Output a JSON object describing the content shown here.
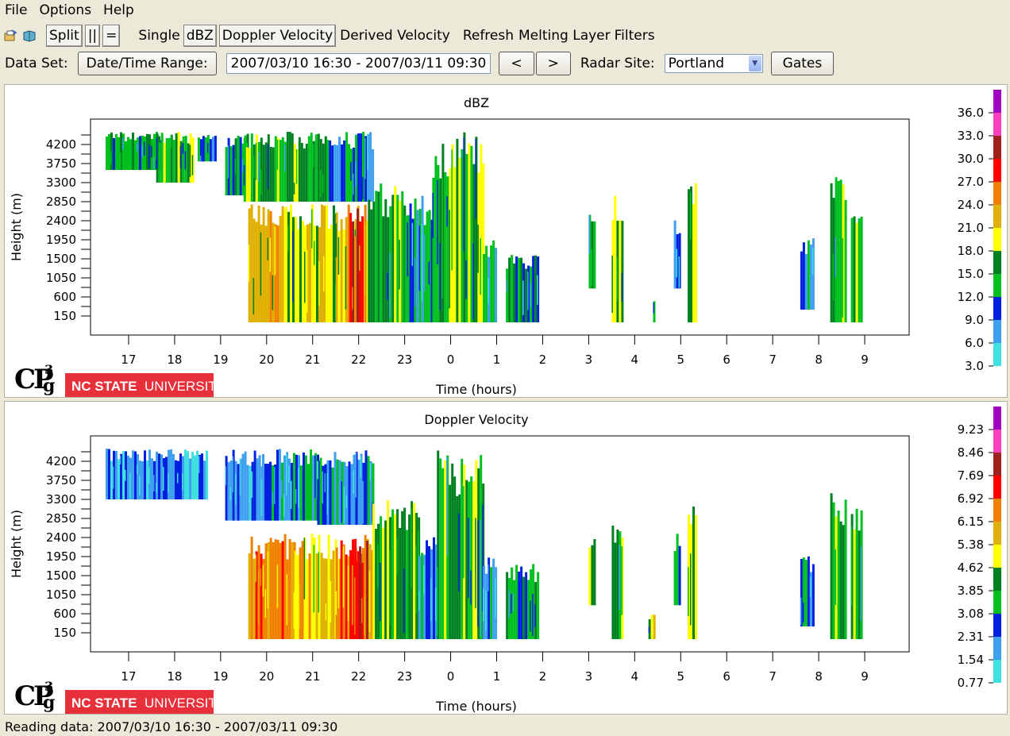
{
  "menu": [
    "File",
    "Options",
    "Help"
  ],
  "toolbar": {
    "split_label": "Split",
    "parallel_label": "||",
    "equal_label": "=",
    "single_label": "Single",
    "dbz_label": "dBZ",
    "doppler_label": "Doppler Velocity",
    "derived_label": "Derived Velocity",
    "refresh_label": "Refresh",
    "melting_label": "Melting Layer",
    "filters_label": "Filters"
  },
  "dataset": {
    "label": "Data Set:",
    "range_button": "Date/Time Range:",
    "range_value": "2007/03/10 16:30 - 2007/03/11 09:30",
    "prev_label": "<",
    "next_label": ">",
    "site_label": "Radar Site:",
    "site_value": "Portland",
    "gates_label": "Gates"
  },
  "colors": [
    "#40e0e0",
    "#40a0f0",
    "#0020e0",
    "#00c020",
    "#008020",
    "#ffff00",
    "#e0b000",
    "#f08000",
    "#ff0000",
    "#a02020",
    "#ff40c0",
    "#a000c0"
  ],
  "chart_data": [
    {
      "type": "heatmap",
      "title": "dBZ",
      "xlabel": "Time (hours)",
      "ylabel": "Height (m)",
      "xticks": [
        "17",
        "18",
        "19",
        "20",
        "21",
        "22",
        "23",
        "0",
        "1",
        "2",
        "3",
        "4",
        "5",
        "6",
        "7",
        "8",
        "9"
      ],
      "yticks": [
        "4200",
        "3750",
        "3300",
        "2850",
        "2400",
        "1950",
        "1500",
        "1050",
        "600",
        "150"
      ],
      "colorbar_labels": [
        "36.0",
        "33.0",
        "30.0",
        "27.0",
        "24.0",
        "21.0",
        "18.0",
        "15.0",
        "12.0",
        "9.0",
        "6.0",
        "3.0"
      ],
      "colorbar_values": [
        36.0,
        33.0,
        30.0,
        27.0,
        24.0,
        21.0,
        18.0,
        15.0,
        12.0,
        9.0,
        6.0,
        3.0
      ],
      "echo_blocks": [
        {
          "t0": 16.5,
          "t1": 17.7,
          "h0": 3600,
          "h1": 4500,
          "level": 3
        },
        {
          "t0": 17.6,
          "t1": 18.4,
          "h0": 3300,
          "h1": 4500,
          "level": 4
        },
        {
          "t0": 18.5,
          "t1": 18.9,
          "h0": 3800,
          "h1": 4500,
          "level": 2
        },
        {
          "t0": 19.1,
          "t1": 19.6,
          "h0": 3000,
          "h1": 4500,
          "level": 3
        },
        {
          "t0": 19.5,
          "t1": 21.3,
          "h0": 2850,
          "h1": 4500,
          "level": 4
        },
        {
          "t0": 21.3,
          "t1": 22.3,
          "h0": 2850,
          "h1": 4500,
          "level": 2
        },
        {
          "t0": 19.6,
          "t1": 20.4,
          "h0": 0,
          "h1": 2850,
          "level": 6
        },
        {
          "t0": 20.4,
          "t1": 21.5,
          "h0": 0,
          "h1": 2850,
          "level": 5
        },
        {
          "t0": 21.5,
          "t1": 22.2,
          "h0": 0,
          "h1": 2850,
          "level": 6
        },
        {
          "t0": 21.8,
          "t1": 22.1,
          "h0": 0,
          "h1": 2700,
          "level": 8
        },
        {
          "t0": 22.2,
          "t1": 23.0,
          "h0": 0,
          "h1": 3300,
          "level": 4
        },
        {
          "t0": 23.0,
          "t1": 23.6,
          "h0": 0,
          "h1": 3000,
          "level": 2
        },
        {
          "t0": 23.6,
          "t1": 0.7,
          "h0": 0,
          "h1": 4500,
          "level": 4
        },
        {
          "t0": 0.7,
          "t1": 1.0,
          "h0": 0,
          "h1": 2000,
          "level": 2
        },
        {
          "t0": 1.2,
          "t1": 1.9,
          "h0": 0,
          "h1": 1600,
          "level": 3
        },
        {
          "t0": 3.0,
          "t1": 3.15,
          "h0": 800,
          "h1": 2600,
          "level": 4
        },
        {
          "t0": 3.5,
          "t1": 3.75,
          "h0": 0,
          "h1": 3000,
          "level": 4
        },
        {
          "t0": 4.4,
          "t1": 4.45,
          "h0": 0,
          "h1": 500,
          "level": 2
        },
        {
          "t0": 4.85,
          "t1": 5.0,
          "h0": 800,
          "h1": 2500,
          "level": 2
        },
        {
          "t0": 5.15,
          "t1": 5.35,
          "h0": 0,
          "h1": 3300,
          "level": 4
        },
        {
          "t0": 7.6,
          "t1": 7.9,
          "h0": 300,
          "h1": 2000,
          "level": 2
        },
        {
          "t0": 8.25,
          "t1": 8.6,
          "h0": 0,
          "h1": 3500,
          "level": 4
        },
        {
          "t0": 8.7,
          "t1": 8.95,
          "h0": 0,
          "h1": 3100,
          "level": 4
        }
      ]
    },
    {
      "type": "heatmap",
      "title": "Doppler Velocity",
      "xlabel": "Time (hours)",
      "ylabel": "Height (m)",
      "xticks": [
        "17",
        "18",
        "19",
        "20",
        "21",
        "22",
        "23",
        "0",
        "1",
        "2",
        "3",
        "4",
        "5",
        "6",
        "7",
        "8",
        "9"
      ],
      "yticks": [
        "4200",
        "3750",
        "3300",
        "2850",
        "2400",
        "1950",
        "1500",
        "1050",
        "600",
        "150"
      ],
      "colorbar_labels": [
        "9.23",
        "8.46",
        "7.69",
        "6.92",
        "6.15",
        "5.38",
        "4.62",
        "3.85",
        "3.08",
        "2.31",
        "1.54",
        "0.77"
      ],
      "colorbar_values": [
        9.23,
        8.46,
        7.69,
        6.92,
        6.15,
        5.38,
        4.62,
        3.85,
        3.08,
        2.31,
        1.54,
        0.77
      ],
      "echo_blocks": [
        {
          "t0": 16.5,
          "t1": 18.7,
          "h0": 3300,
          "h1": 4500,
          "level": 1
        },
        {
          "t0": 19.1,
          "t1": 19.9,
          "h0": 2800,
          "h1": 4500,
          "level": 1
        },
        {
          "t0": 19.9,
          "t1": 21.1,
          "h0": 2800,
          "h1": 4500,
          "level": 2
        },
        {
          "t0": 21.1,
          "t1": 22.3,
          "h0": 2700,
          "h1": 4500,
          "level": 2
        },
        {
          "t0": 19.6,
          "t1": 20.6,
          "h0": 0,
          "h1": 2500,
          "level": 7
        },
        {
          "t0": 20.6,
          "t1": 21.5,
          "h0": 0,
          "h1": 2500,
          "level": 6
        },
        {
          "t0": 21.5,
          "t1": 22.3,
          "h0": 0,
          "h1": 2500,
          "level": 7
        },
        {
          "t0": 21.8,
          "t1": 22.2,
          "h0": 0,
          "h1": 2400,
          "level": 8
        },
        {
          "t0": 22.3,
          "t1": 23.3,
          "h0": 0,
          "h1": 3300,
          "level": 4
        },
        {
          "t0": 23.3,
          "t1": 23.7,
          "h0": 0,
          "h1": 2500,
          "level": 2
        },
        {
          "t0": 23.7,
          "t1": 0.7,
          "h0": 0,
          "h1": 4500,
          "level": 4
        },
        {
          "t0": 0.7,
          "t1": 1.0,
          "h0": 0,
          "h1": 2000,
          "level": 2
        },
        {
          "t0": 1.2,
          "t1": 1.9,
          "h0": 0,
          "h1": 1800,
          "level": 3
        },
        {
          "t0": 3.0,
          "t1": 3.15,
          "h0": 800,
          "h1": 2600,
          "level": 4
        },
        {
          "t0": 3.5,
          "t1": 3.75,
          "h0": 0,
          "h1": 3000,
          "level": 4
        },
        {
          "t0": 4.3,
          "t1": 4.45,
          "h0": 0,
          "h1": 600,
          "level": 5
        },
        {
          "t0": 4.85,
          "t1": 5.0,
          "h0": 800,
          "h1": 2500,
          "level": 3
        },
        {
          "t0": 5.15,
          "t1": 5.35,
          "h0": 0,
          "h1": 3300,
          "level": 4
        },
        {
          "t0": 7.6,
          "t1": 7.9,
          "h0": 300,
          "h1": 2000,
          "level": 2
        },
        {
          "t0": 8.25,
          "t1": 8.6,
          "h0": 0,
          "h1": 3500,
          "level": 4
        },
        {
          "t0": 8.7,
          "t1": 8.95,
          "h0": 0,
          "h1": 3100,
          "level": 4
        }
      ]
    }
  ],
  "logo": {
    "cp_text": "CP",
    "g_text": "g",
    "sup": "3",
    "nc_state": "NC STATE",
    "university": "UNIVERSITY"
  },
  "status": "Reading data: 2007/03/10 16:30 - 2007/03/11 09:30"
}
